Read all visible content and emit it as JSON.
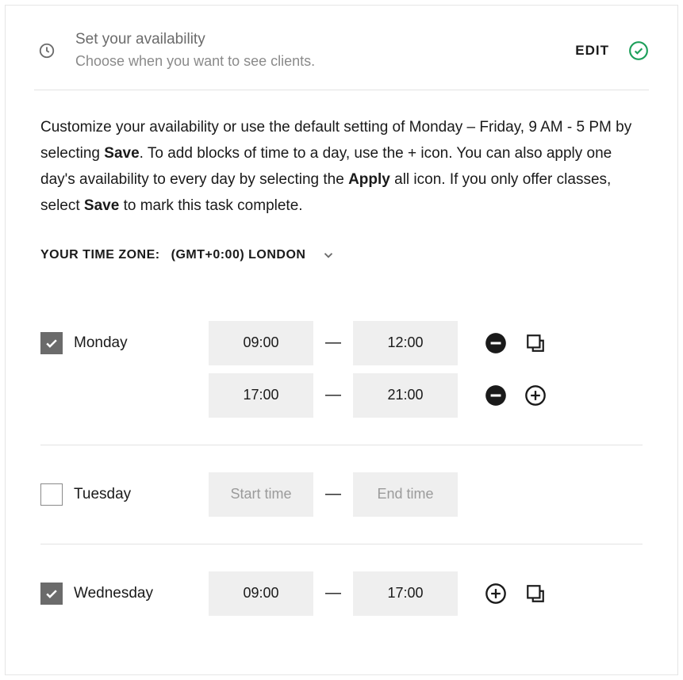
{
  "header": {
    "title": "Set your availability",
    "subtitle": "Choose when you want to see clients.",
    "edit_label": "EDIT"
  },
  "description": {
    "t1": "Customize your availability or use the default setting of Monday – Friday, 9 AM - 5 PM by selecting ",
    "b1": "Save",
    "t2": ". To add blocks of time to a day, use the + icon. You can also apply one day's availability to every day by selecting the ",
    "b2": "Apply",
    "t3": " all icon. If you only offer classes, select ",
    "b3": "Save",
    "t4": " to mark this task complete."
  },
  "timezone": {
    "label": "YOUR TIME ZONE:",
    "value": "(GMT+0:00) LONDON"
  },
  "days": {
    "monday": {
      "label": "Monday",
      "checked": true,
      "slots": [
        {
          "start": "09:00",
          "end": "12:00"
        },
        {
          "start": "17:00",
          "end": "21:00"
        }
      ]
    },
    "tuesday": {
      "label": "Tuesday",
      "checked": false,
      "placeholder_start": "Start time",
      "placeholder_end": "End time"
    },
    "wednesday": {
      "label": "Wednesday",
      "checked": true,
      "slots": [
        {
          "start": "09:00",
          "end": "17:00"
        }
      ]
    }
  },
  "dash": "—"
}
